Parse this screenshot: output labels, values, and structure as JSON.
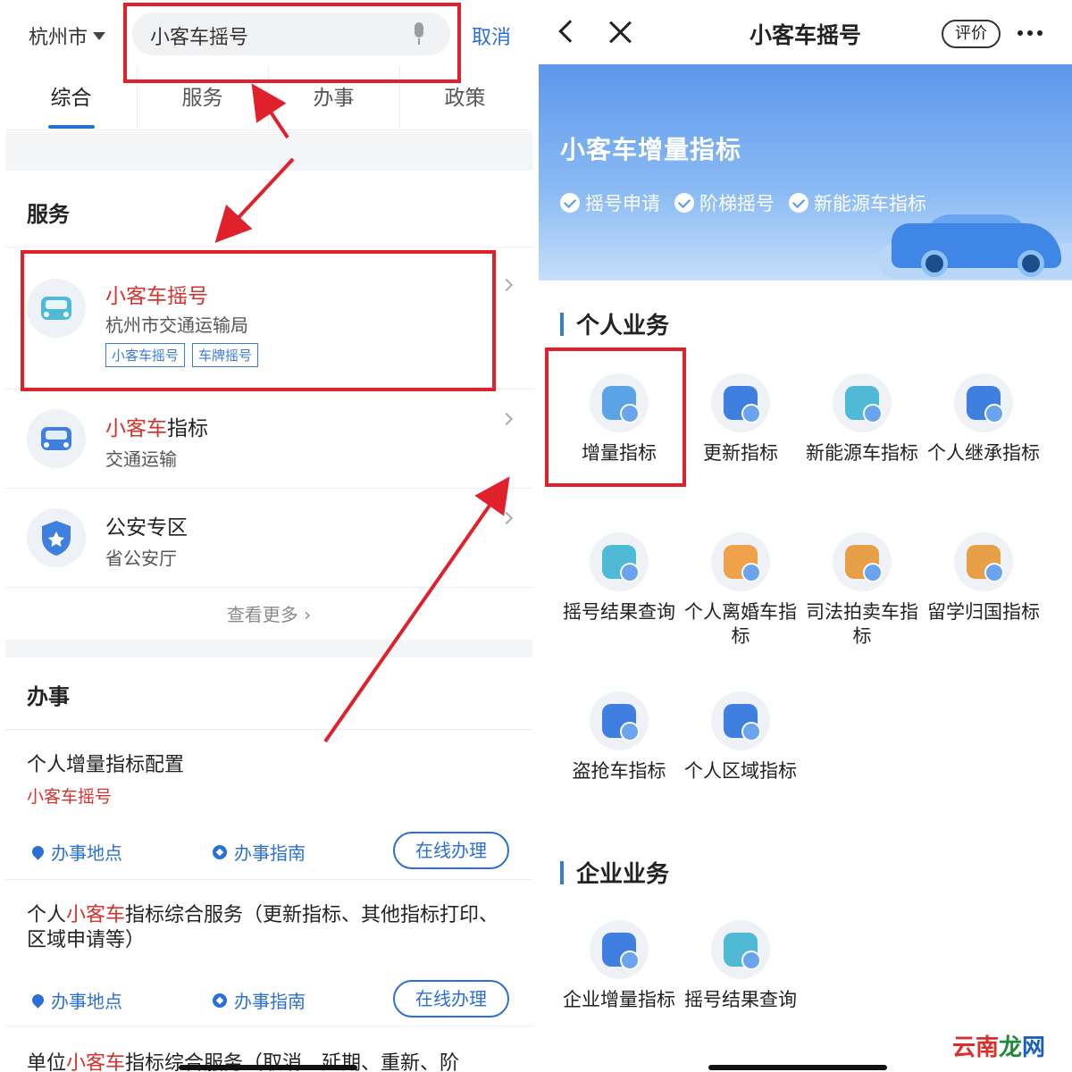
{
  "left": {
    "city": "杭州市",
    "search_value": "小客车摇号",
    "cancel": "取消",
    "tabs": [
      "综合",
      "服务",
      "办事",
      "政策"
    ],
    "services_heading": "服务",
    "services": [
      {
        "title_hl": "小客车摇号",
        "title_rest": "",
        "sub": "杭州市交通运输局",
        "tags": [
          "小客车摇号",
          "车牌摇号"
        ]
      },
      {
        "title_hl": "小客车",
        "title_rest": "指标",
        "sub": "交通运输"
      },
      {
        "title_hl": "",
        "title_rest": "公安专区",
        "sub": "省公安厅"
      }
    ],
    "more": "查看更多 ›",
    "jobs_heading": "办事",
    "jobs": [
      {
        "title_pre": "个人增量指标配置",
        "title_hl": "",
        "title_post": "",
        "sub": "小客车摇号",
        "loc": "办事地点",
        "guide": "办事指南",
        "btn": "在线办理"
      },
      {
        "title_pre": "个人",
        "title_hl": "小客车",
        "title_post": "指标综合服务（更新指标、其他指标打印、区域申请等）",
        "loc": "办事地点",
        "guide": "办事指南",
        "btn": "在线办理"
      },
      {
        "title_pre": "单位",
        "title_hl": "小客车",
        "title_post": "指标综合服务（取消、延期、重新、阶"
      }
    ]
  },
  "right": {
    "nav_title": "小客车摇号",
    "rate": "评价",
    "banner_title": "小客车增量指标",
    "banner_features": [
      "摇号申请",
      "阶梯摇号",
      "新能源车指标"
    ],
    "personal_heading": "个人业务",
    "personal_items": [
      "增量指标",
      "更新指标",
      "新能源车指标",
      "个人继承指标",
      "摇号结果查询",
      "个人离婚车指标",
      "司法拍卖车指标",
      "留学归国指标",
      "盗抢车指标",
      "个人区域指标"
    ],
    "enterprise_heading": "企业业务",
    "enterprise_items": [
      "企业增量指标",
      "摇号结果查询"
    ],
    "icons": [
      "shield-chart-icon",
      "refresh-icon",
      "ev-car-icon",
      "id-card-icon",
      "search-query-icon",
      "broken-heart-icon",
      "gavel-icon",
      "graduation-cap-icon",
      "stolen-car-icon",
      "area-car-icon",
      "building-icon",
      "search-query-icon"
    ]
  },
  "watermark": {
    "a": "云南",
    "b": "龙",
    "c": "网"
  },
  "colors": {
    "accent": "#2a6fd6",
    "highlight": "#d8312c",
    "annotation": "#e0202a",
    "banner": "#5d97ec"
  }
}
